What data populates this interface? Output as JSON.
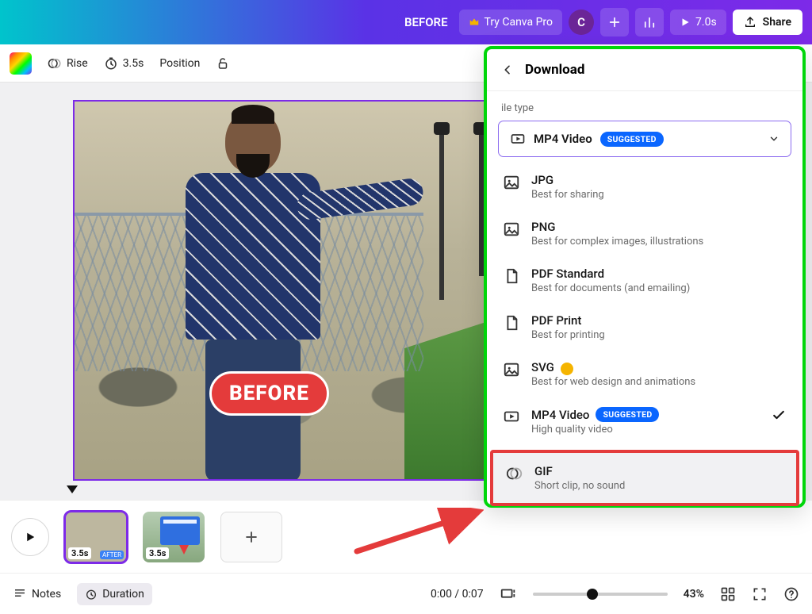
{
  "topbar": {
    "title": "BEFORE",
    "try_pro": "Try Canva Pro",
    "avatar_initial": "C",
    "play_duration": "7.0s",
    "share": "Share"
  },
  "toolbar": {
    "rise": "Rise",
    "timing": "3.5s",
    "position": "Position"
  },
  "canvas": {
    "before_pill": "BEFORE"
  },
  "timeline": {
    "thumbs": [
      {
        "duration": "3.5s",
        "tag": "AFTER"
      },
      {
        "duration": "3.5s",
        "tag": ""
      }
    ]
  },
  "bottom": {
    "notes": "Notes",
    "duration": "Duration",
    "time": "0:00 / 0:07",
    "zoom": "43%"
  },
  "panel": {
    "title": "Download",
    "file_type_label": "ile type",
    "selected": {
      "name": "MP4 Video",
      "badge": "SUGGESTED"
    },
    "options": [
      {
        "key": "jpg",
        "name": "JPG",
        "desc": "Best for sharing"
      },
      {
        "key": "png",
        "name": "PNG",
        "desc": "Best for complex images, illustrations"
      },
      {
        "key": "pdf_std",
        "name": "PDF Standard",
        "desc": "Best for documents (and emailing)"
      },
      {
        "key": "pdf_print",
        "name": "PDF Print",
        "desc": "Best for printing"
      },
      {
        "key": "svg",
        "name": "SVG",
        "desc": "Best for web design and animations",
        "crown": true
      },
      {
        "key": "mp4",
        "name": "MP4 Video",
        "desc": "High quality video",
        "badge": "SUGGESTED",
        "checked": true
      },
      {
        "key": "gif",
        "name": "GIF",
        "desc": "Short clip, no sound",
        "highlight": true
      }
    ]
  }
}
